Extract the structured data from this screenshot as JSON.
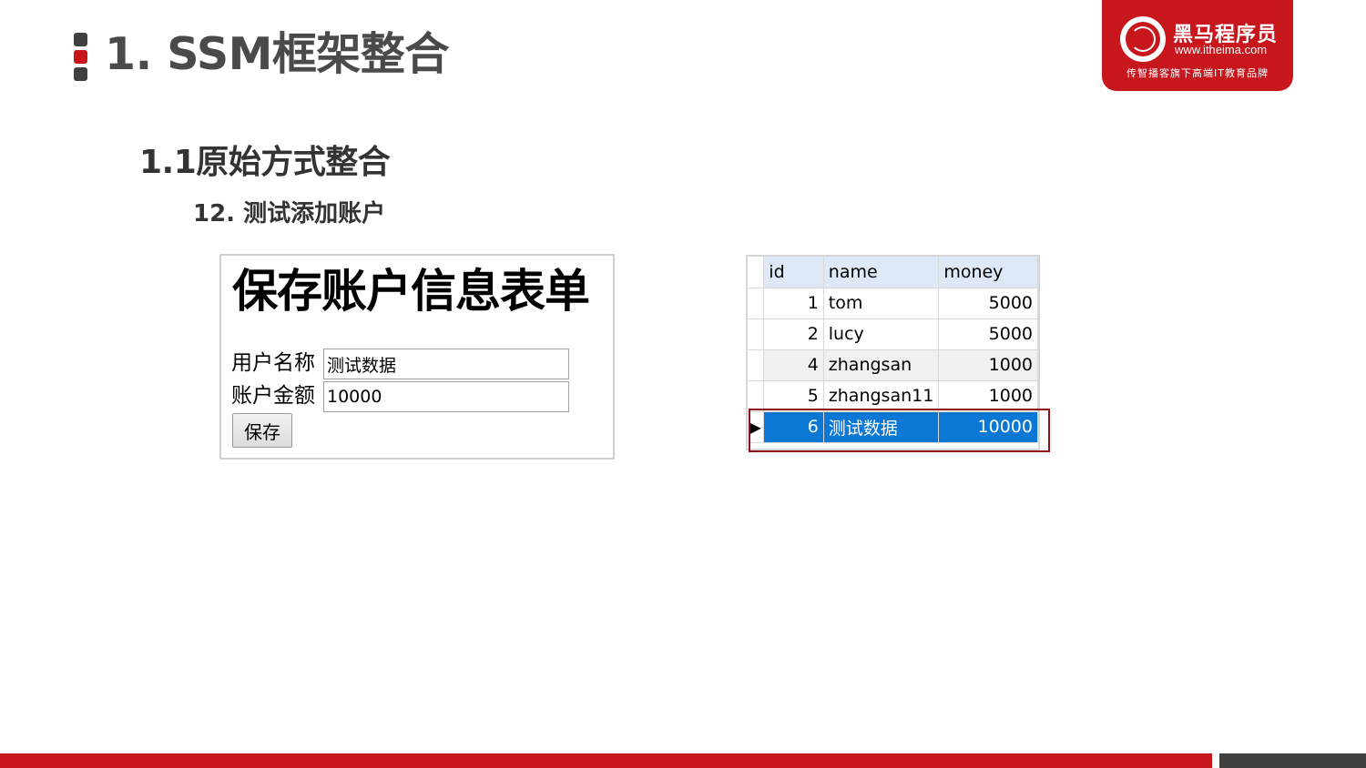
{
  "slide": {
    "title": "1. SSM框架整合",
    "section": "1.1原始方式整合",
    "subsection": "12. 测试添加账户"
  },
  "logo": {
    "brand": "黑马程序员",
    "url": "www.itheima.com",
    "slogan": "传智播客旗下高端IT教育品牌"
  },
  "form": {
    "heading": "保存账户信息表单",
    "name_label": "用户名称",
    "name_value": "测试数据",
    "money_label": "账户金额",
    "money_value": "10000",
    "save_label": "保存"
  },
  "db_table": {
    "columns": [
      "id",
      "name",
      "money"
    ],
    "rows": [
      {
        "id": "1",
        "name": "tom",
        "money": "5000"
      },
      {
        "id": "2",
        "name": "lucy",
        "money": "5000"
      },
      {
        "id": "4",
        "name": "zhangsan",
        "money": "1000"
      },
      {
        "id": "5",
        "name": "zhangsan11",
        "money": "1000"
      },
      {
        "id": "6",
        "name": "测试数据",
        "money": "10000"
      }
    ],
    "current_row_icon": "▶",
    "selected_row_color": "#0a78d4"
  },
  "colors": {
    "brand_red": "#c8161d",
    "dark_gray": "#3f3f3f"
  }
}
